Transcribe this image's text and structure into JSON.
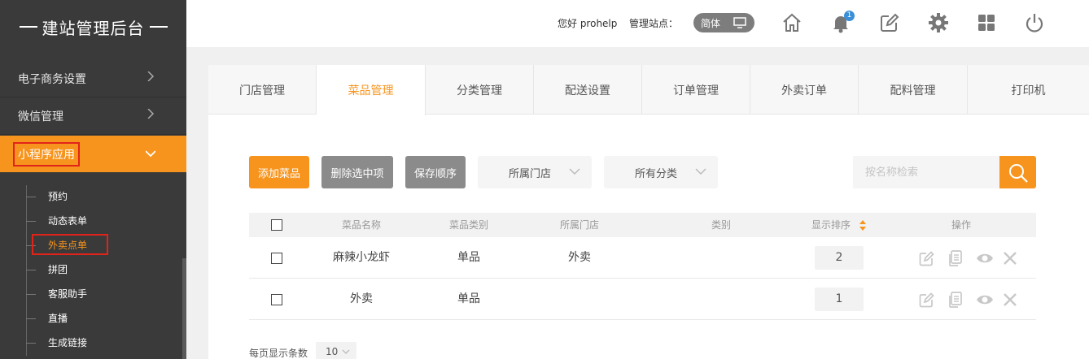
{
  "brand": {
    "title": "建站管理后台"
  },
  "sidebar": {
    "items": [
      {
        "label": "电子商务设置"
      },
      {
        "label": "微信管理"
      },
      {
        "label": "小程序应用"
      }
    ],
    "submenu": [
      {
        "label": "预约"
      },
      {
        "label": "动态表单"
      },
      {
        "label": "外卖点单"
      },
      {
        "label": "拼团"
      },
      {
        "label": "客服助手"
      },
      {
        "label": "直播"
      },
      {
        "label": "生成链接"
      }
    ]
  },
  "topbar": {
    "greeting": "您好 prohelp",
    "site_label": "管理站点：",
    "language": "简体",
    "notification_count": "1",
    "icons": [
      "home-icon",
      "bell-icon",
      "edit-icon",
      "gear-icon",
      "grid-icon",
      "power-icon"
    ]
  },
  "tabs": [
    {
      "label": "门店管理"
    },
    {
      "label": "菜品管理"
    },
    {
      "label": "分类管理"
    },
    {
      "label": "配送设置"
    },
    {
      "label": "订单管理"
    },
    {
      "label": "外卖订单"
    },
    {
      "label": "配料管理"
    },
    {
      "label": "打印机"
    }
  ],
  "toolbar": {
    "add": "添加菜品",
    "delete": "删除选中项",
    "save_order": "保存顺序",
    "store_select": "所属门店",
    "category_select": "所有分类",
    "search_placeholder": "按名称检索"
  },
  "table": {
    "headers": [
      "菜品名称",
      "菜品类别",
      "所属门店",
      "类别",
      "显示排序",
      "操作"
    ],
    "rows": [
      {
        "name": "麻辣小龙虾",
        "type": "单品",
        "store": "外卖",
        "category": "",
        "order": "2"
      },
      {
        "name": "外卖",
        "type": "单品",
        "store": "",
        "category": "",
        "order": "1"
      }
    ]
  },
  "pager": {
    "label": "每页显示条数",
    "value": "10"
  },
  "colors": {
    "accent": "#f7941d",
    "sidebar": "#3a3a3a",
    "highlight_box": "#e2231a"
  }
}
